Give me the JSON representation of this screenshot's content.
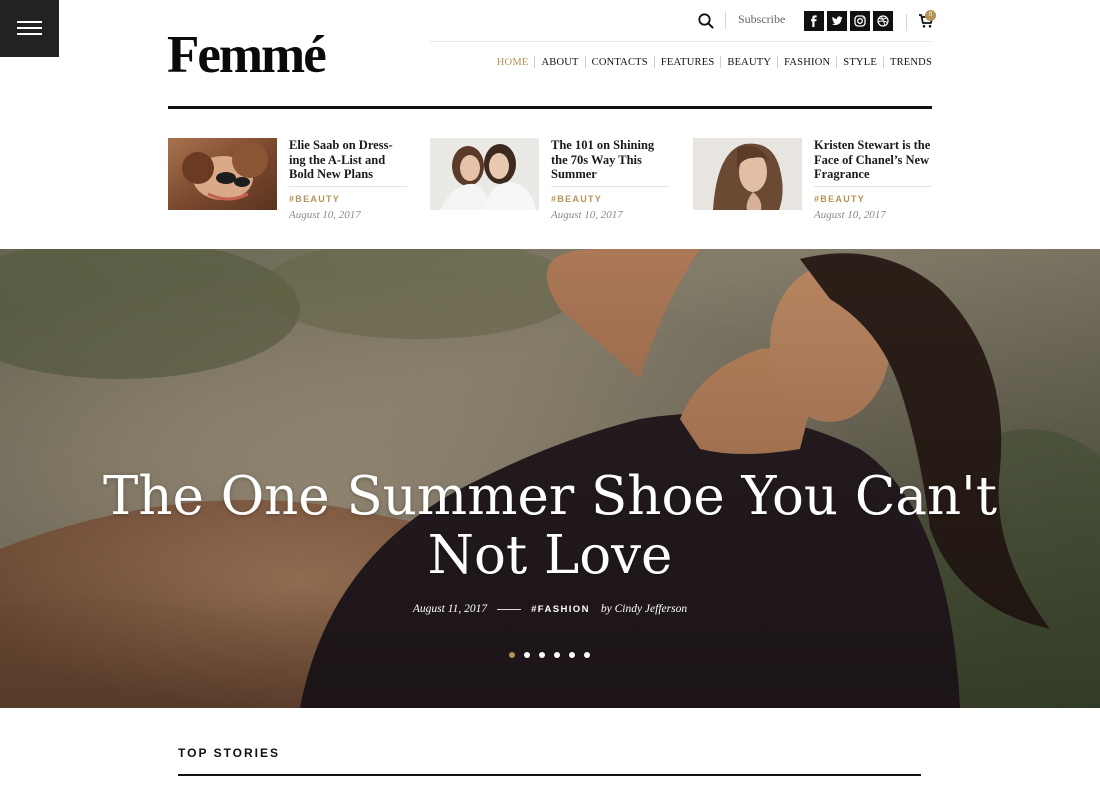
{
  "header": {
    "logo_text": "Femmé",
    "subscribe_label": "Subscribe",
    "cart_count": "0",
    "social_icons": [
      "facebook-icon",
      "twitter-icon",
      "instagram-icon",
      "dribbble-icon"
    ]
  },
  "nav": {
    "items": [
      {
        "label": "HOME",
        "active": true
      },
      {
        "label": "ABOUT"
      },
      {
        "label": "CONTACTS"
      },
      {
        "label": "FEATURES"
      },
      {
        "label": "BEAUTY"
      },
      {
        "label": "FASHION"
      },
      {
        "label": "STYLE"
      },
      {
        "label": "TRENDS"
      }
    ]
  },
  "featured": [
    {
      "title": "Elie Saab on Dress-ing the A-List and Bold New Plans",
      "tag": "#BEAUTY",
      "date": "August 10, 2017"
    },
    {
      "title": "The 101 on Shining the 70s Way This Summer",
      "tag": "#BEAUTY",
      "date": "August 10, 2017"
    },
    {
      "title": "Kristen Stewart is the Face of Chanel’s New Fragrance",
      "tag": "#BEAUTY",
      "date": "August 10, 2017"
    }
  ],
  "hero": {
    "title": "The One Summer Shoe You Can't Not Love",
    "date": "August 11, 2017",
    "tag": "#FASHION",
    "author": "by Cindy Jefferson",
    "slides_count": 6,
    "active_slide": 1
  },
  "top_stories": {
    "title": "TOP STORIES"
  },
  "colors": {
    "accent": "#b59355",
    "dark": "#111111",
    "menu_bg": "#222222"
  }
}
